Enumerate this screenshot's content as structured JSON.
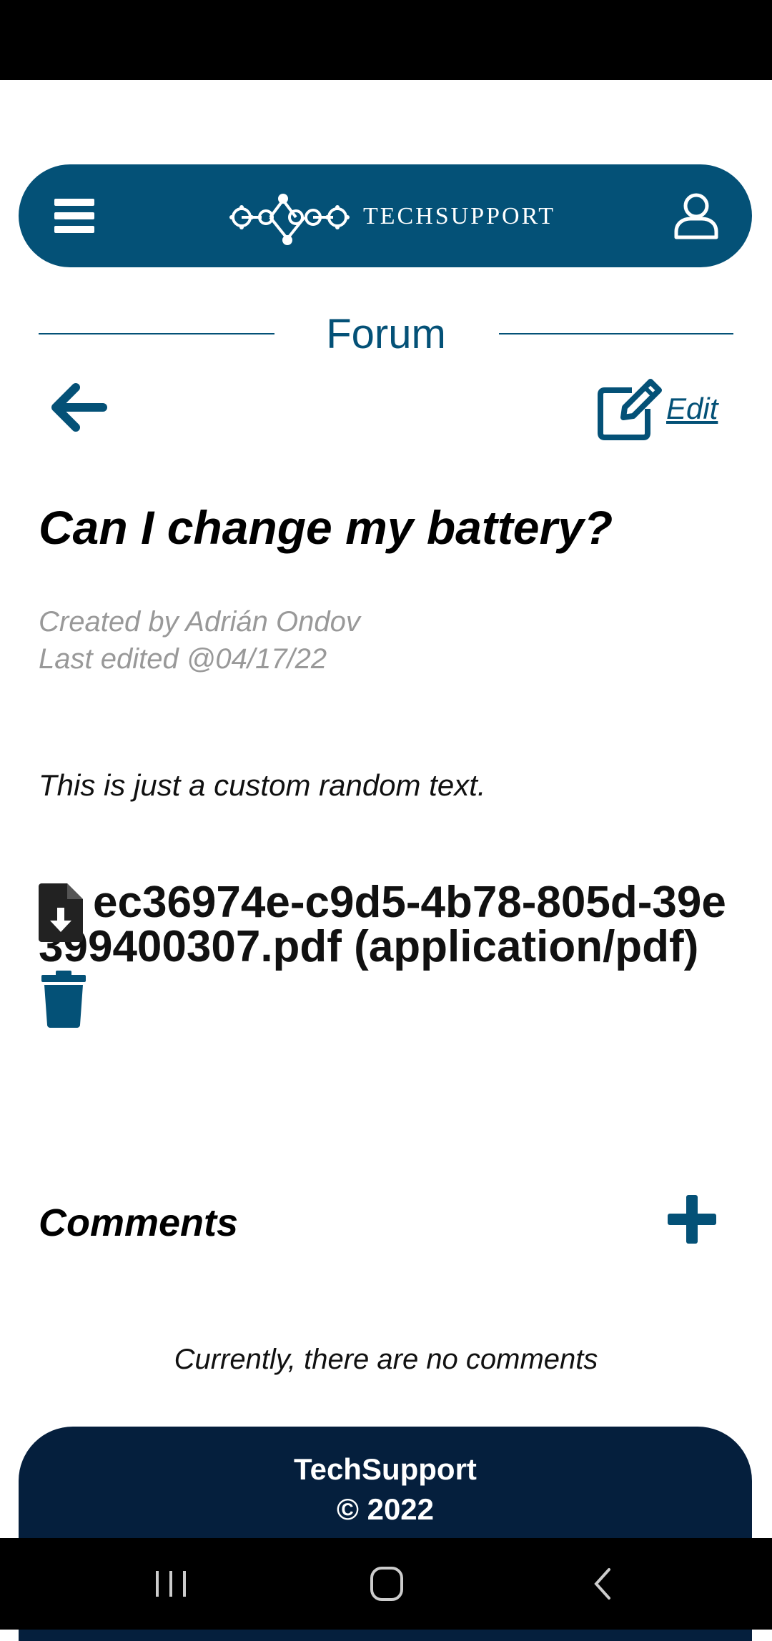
{
  "header": {
    "brand": "TECHSUPPORT",
    "menu_icon": "hamburger-menu-icon",
    "user_icon": "user-icon"
  },
  "forum": {
    "title": "Forum"
  },
  "actions": {
    "edit_label": "Edit"
  },
  "post": {
    "title": "Can I change my battery?",
    "created_by": "Created by Adrián Ondov",
    "last_edited": "Last edited @04/17/22",
    "body": "This is just a custom random text.",
    "attachment": "ec36974e-c9d5-4b78-805d-39e399400307.pdf (application/pdf)"
  },
  "comments": {
    "title": "Comments",
    "empty_text": "Currently, there are no comments"
  },
  "footer": {
    "name": "TechSupport",
    "copyright": "© 2022"
  },
  "colors": {
    "primary": "#045177",
    "footer": "#051f3d",
    "muted": "#999999"
  }
}
